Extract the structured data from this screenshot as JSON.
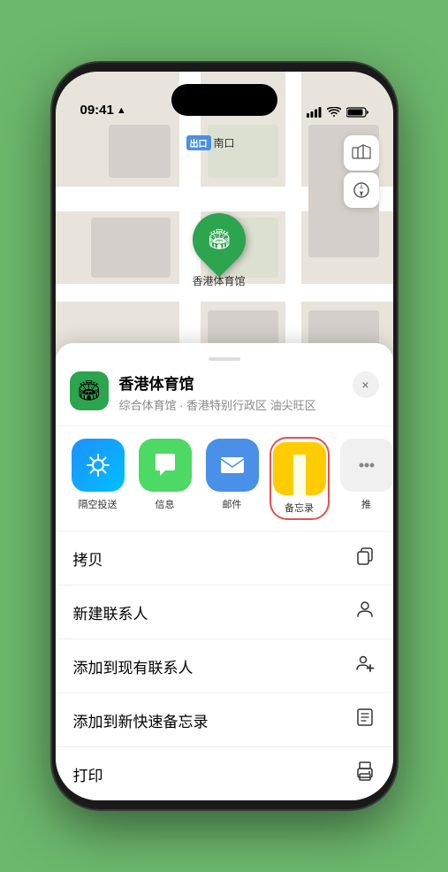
{
  "status_bar": {
    "time": "09:41",
    "location_icon": "▲"
  },
  "map": {
    "label_badge": "出口",
    "label_text": "南口",
    "stadium_name": "香港体育馆",
    "controls": {
      "map_btn": "🗺",
      "location_btn": "⊕"
    }
  },
  "location_card": {
    "name": "香港体育馆",
    "description": "综合体育馆 · 香港特别行政区 油尖旺区",
    "close_label": "×"
  },
  "share_items": [
    {
      "id": "airdrop",
      "label": "隔空投送",
      "type": "airdrop"
    },
    {
      "id": "message",
      "label": "信息",
      "type": "message"
    },
    {
      "id": "mail",
      "label": "邮件",
      "type": "mail"
    },
    {
      "id": "notes",
      "label": "备忘录",
      "type": "notes"
    },
    {
      "id": "more",
      "label": "推",
      "type": "more"
    }
  ],
  "actions": [
    {
      "id": "copy",
      "label": "拷贝",
      "icon": "copy"
    },
    {
      "id": "new-contact",
      "label": "新建联系人",
      "icon": "person"
    },
    {
      "id": "add-contact",
      "label": "添加到现有联系人",
      "icon": "person-add"
    },
    {
      "id": "quick-note",
      "label": "添加到新快速备忘录",
      "icon": "note"
    },
    {
      "id": "print",
      "label": "打印",
      "icon": "print"
    }
  ]
}
